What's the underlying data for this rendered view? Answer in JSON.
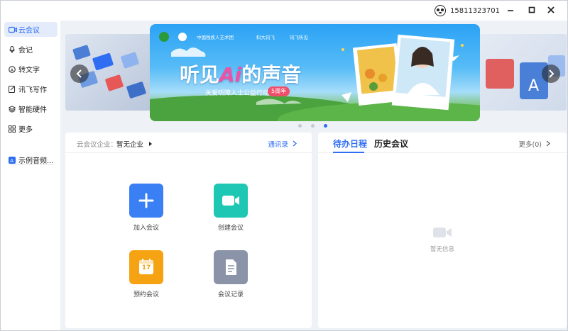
{
  "titlebar": {
    "phone": "15811323701",
    "minimize_icon": "minimize-icon",
    "maximize_icon": "maximize-icon",
    "close_icon": "close-icon"
  },
  "sidebar": {
    "items": [
      {
        "label": "云会议",
        "icon": "video-icon",
        "active": true
      },
      {
        "label": "会记",
        "icon": "mic-icon"
      },
      {
        "label": "转文字",
        "icon": "transcribe-icon"
      },
      {
        "label": "讯飞写作",
        "icon": "write-icon"
      },
      {
        "label": "智能硬件",
        "icon": "hardware-icon"
      },
      {
        "label": "更多",
        "icon": "grid-icon"
      },
      {
        "label": "示例音频...",
        "icon": "audio-file-icon"
      }
    ]
  },
  "banner": {
    "partner_text": "中国残疾人艺术团",
    "brand_text": "科大讯飞",
    "brand_sub": "讯飞听见",
    "headline_pre": "听见",
    "headline_ai": "Ai",
    "headline_post": "的声音",
    "subline": "关爱听障人士公益行动",
    "badge": "5周年",
    "dots": [
      false,
      false,
      true
    ]
  },
  "meeting_panel": {
    "company_label": "云会议企业：",
    "company_value": "暂无企业",
    "contacts_link": "通讯录",
    "actions": [
      {
        "label": "加入会议",
        "icon": "plus-icon",
        "color": "#3b7ff5"
      },
      {
        "label": "创建会议",
        "icon": "camera-icon",
        "color": "#1ec7b3"
      },
      {
        "label": "预约会议",
        "icon": "calendar-icon",
        "color": "#f5a313",
        "calendar_day": "17"
      },
      {
        "label": "会议记录",
        "icon": "document-icon",
        "color": "#8a93a8"
      }
    ]
  },
  "schedule_panel": {
    "tabs": [
      {
        "label": "待办日程",
        "active": true
      },
      {
        "label": "历史会议",
        "active": false
      }
    ],
    "more_link": "更多(0)",
    "empty_text": "暂无信息"
  }
}
